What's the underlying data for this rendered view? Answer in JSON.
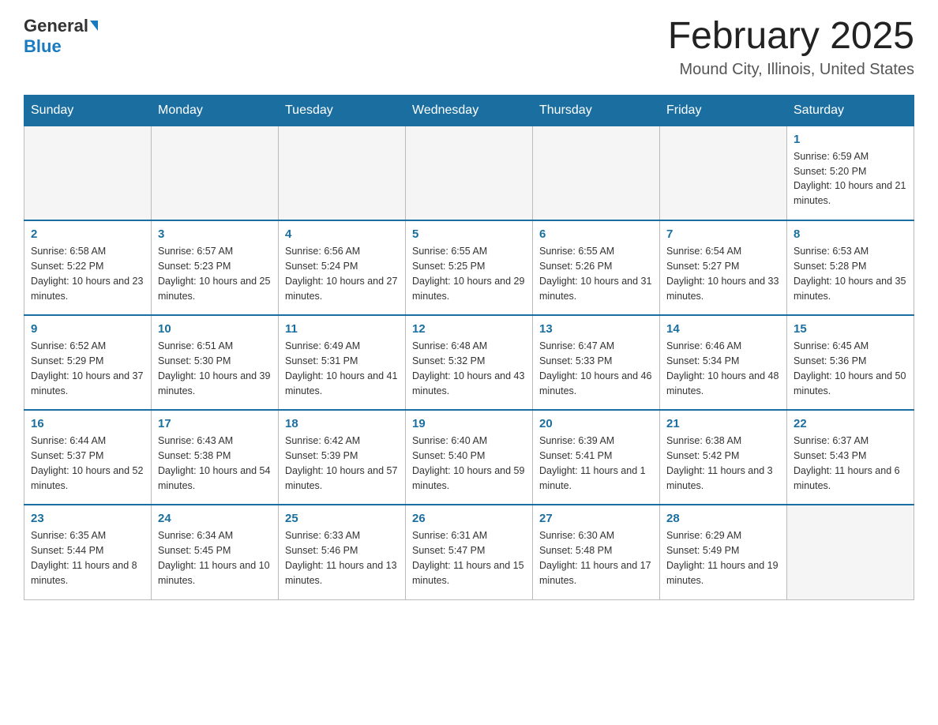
{
  "header": {
    "logo_general": "General",
    "logo_blue": "Blue",
    "month_title": "February 2025",
    "location": "Mound City, Illinois, United States"
  },
  "weekdays": [
    "Sunday",
    "Monday",
    "Tuesday",
    "Wednesday",
    "Thursday",
    "Friday",
    "Saturday"
  ],
  "weeks": [
    [
      {
        "day": "",
        "sunrise": "",
        "sunset": "",
        "daylight": ""
      },
      {
        "day": "",
        "sunrise": "",
        "sunset": "",
        "daylight": ""
      },
      {
        "day": "",
        "sunrise": "",
        "sunset": "",
        "daylight": ""
      },
      {
        "day": "",
        "sunrise": "",
        "sunset": "",
        "daylight": ""
      },
      {
        "day": "",
        "sunrise": "",
        "sunset": "",
        "daylight": ""
      },
      {
        "day": "",
        "sunrise": "",
        "sunset": "",
        "daylight": ""
      },
      {
        "day": "1",
        "sunrise": "Sunrise: 6:59 AM",
        "sunset": "Sunset: 5:20 PM",
        "daylight": "Daylight: 10 hours and 21 minutes."
      }
    ],
    [
      {
        "day": "2",
        "sunrise": "Sunrise: 6:58 AM",
        "sunset": "Sunset: 5:22 PM",
        "daylight": "Daylight: 10 hours and 23 minutes."
      },
      {
        "day": "3",
        "sunrise": "Sunrise: 6:57 AM",
        "sunset": "Sunset: 5:23 PM",
        "daylight": "Daylight: 10 hours and 25 minutes."
      },
      {
        "day": "4",
        "sunrise": "Sunrise: 6:56 AM",
        "sunset": "Sunset: 5:24 PM",
        "daylight": "Daylight: 10 hours and 27 minutes."
      },
      {
        "day": "5",
        "sunrise": "Sunrise: 6:55 AM",
        "sunset": "Sunset: 5:25 PM",
        "daylight": "Daylight: 10 hours and 29 minutes."
      },
      {
        "day": "6",
        "sunrise": "Sunrise: 6:55 AM",
        "sunset": "Sunset: 5:26 PM",
        "daylight": "Daylight: 10 hours and 31 minutes."
      },
      {
        "day": "7",
        "sunrise": "Sunrise: 6:54 AM",
        "sunset": "Sunset: 5:27 PM",
        "daylight": "Daylight: 10 hours and 33 minutes."
      },
      {
        "day": "8",
        "sunrise": "Sunrise: 6:53 AM",
        "sunset": "Sunset: 5:28 PM",
        "daylight": "Daylight: 10 hours and 35 minutes."
      }
    ],
    [
      {
        "day": "9",
        "sunrise": "Sunrise: 6:52 AM",
        "sunset": "Sunset: 5:29 PM",
        "daylight": "Daylight: 10 hours and 37 minutes."
      },
      {
        "day": "10",
        "sunrise": "Sunrise: 6:51 AM",
        "sunset": "Sunset: 5:30 PM",
        "daylight": "Daylight: 10 hours and 39 minutes."
      },
      {
        "day": "11",
        "sunrise": "Sunrise: 6:49 AM",
        "sunset": "Sunset: 5:31 PM",
        "daylight": "Daylight: 10 hours and 41 minutes."
      },
      {
        "day": "12",
        "sunrise": "Sunrise: 6:48 AM",
        "sunset": "Sunset: 5:32 PM",
        "daylight": "Daylight: 10 hours and 43 minutes."
      },
      {
        "day": "13",
        "sunrise": "Sunrise: 6:47 AM",
        "sunset": "Sunset: 5:33 PM",
        "daylight": "Daylight: 10 hours and 46 minutes."
      },
      {
        "day": "14",
        "sunrise": "Sunrise: 6:46 AM",
        "sunset": "Sunset: 5:34 PM",
        "daylight": "Daylight: 10 hours and 48 minutes."
      },
      {
        "day": "15",
        "sunrise": "Sunrise: 6:45 AM",
        "sunset": "Sunset: 5:36 PM",
        "daylight": "Daylight: 10 hours and 50 minutes."
      }
    ],
    [
      {
        "day": "16",
        "sunrise": "Sunrise: 6:44 AM",
        "sunset": "Sunset: 5:37 PM",
        "daylight": "Daylight: 10 hours and 52 minutes."
      },
      {
        "day": "17",
        "sunrise": "Sunrise: 6:43 AM",
        "sunset": "Sunset: 5:38 PM",
        "daylight": "Daylight: 10 hours and 54 minutes."
      },
      {
        "day": "18",
        "sunrise": "Sunrise: 6:42 AM",
        "sunset": "Sunset: 5:39 PM",
        "daylight": "Daylight: 10 hours and 57 minutes."
      },
      {
        "day": "19",
        "sunrise": "Sunrise: 6:40 AM",
        "sunset": "Sunset: 5:40 PM",
        "daylight": "Daylight: 10 hours and 59 minutes."
      },
      {
        "day": "20",
        "sunrise": "Sunrise: 6:39 AM",
        "sunset": "Sunset: 5:41 PM",
        "daylight": "Daylight: 11 hours and 1 minute."
      },
      {
        "day": "21",
        "sunrise": "Sunrise: 6:38 AM",
        "sunset": "Sunset: 5:42 PM",
        "daylight": "Daylight: 11 hours and 3 minutes."
      },
      {
        "day": "22",
        "sunrise": "Sunrise: 6:37 AM",
        "sunset": "Sunset: 5:43 PM",
        "daylight": "Daylight: 11 hours and 6 minutes."
      }
    ],
    [
      {
        "day": "23",
        "sunrise": "Sunrise: 6:35 AM",
        "sunset": "Sunset: 5:44 PM",
        "daylight": "Daylight: 11 hours and 8 minutes."
      },
      {
        "day": "24",
        "sunrise": "Sunrise: 6:34 AM",
        "sunset": "Sunset: 5:45 PM",
        "daylight": "Daylight: 11 hours and 10 minutes."
      },
      {
        "day": "25",
        "sunrise": "Sunrise: 6:33 AM",
        "sunset": "Sunset: 5:46 PM",
        "daylight": "Daylight: 11 hours and 13 minutes."
      },
      {
        "day": "26",
        "sunrise": "Sunrise: 6:31 AM",
        "sunset": "Sunset: 5:47 PM",
        "daylight": "Daylight: 11 hours and 15 minutes."
      },
      {
        "day": "27",
        "sunrise": "Sunrise: 6:30 AM",
        "sunset": "Sunset: 5:48 PM",
        "daylight": "Daylight: 11 hours and 17 minutes."
      },
      {
        "day": "28",
        "sunrise": "Sunrise: 6:29 AM",
        "sunset": "Sunset: 5:49 PM",
        "daylight": "Daylight: 11 hours and 19 minutes."
      },
      {
        "day": "",
        "sunrise": "",
        "sunset": "",
        "daylight": ""
      }
    ]
  ]
}
